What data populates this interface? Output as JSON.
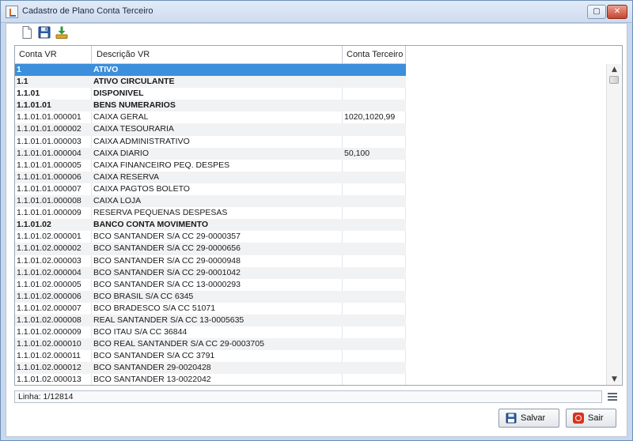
{
  "window": {
    "title": "Cadastro de Plano Conta Terceiro",
    "restore_glyph": "▢",
    "close_glyph": "✕"
  },
  "toolbar": {
    "buttons": [
      {
        "icon": "new-document-icon"
      },
      {
        "icon": "save-floppy-icon"
      },
      {
        "icon": "import-download-icon"
      }
    ]
  },
  "table": {
    "headers": [
      "Conta VR",
      "Descrição VR",
      "Conta Terceiro"
    ],
    "rows": [
      {
        "conta": "1",
        "descricao": "ATIVO",
        "terceiro": "",
        "bold": true,
        "selected": true
      },
      {
        "conta": "1.1",
        "descricao": "ATIVO CIRCULANTE",
        "terceiro": "",
        "bold": true
      },
      {
        "conta": "1.1.01",
        "descricao": "DISPONIVEL",
        "terceiro": "",
        "bold": true
      },
      {
        "conta": "1.1.01.01",
        "descricao": "BENS NUMERARIOS",
        "terceiro": "",
        "bold": true
      },
      {
        "conta": "1.1.01.01.000001",
        "descricao": "CAIXA GERAL",
        "terceiro": "1020,1020,99"
      },
      {
        "conta": "1.1.01.01.000002",
        "descricao": "CAIXA TESOURARIA",
        "terceiro": ""
      },
      {
        "conta": "1.1.01.01.000003",
        "descricao": "CAIXA ADMINISTRATIVO",
        "terceiro": ""
      },
      {
        "conta": "1.1.01.01.000004",
        "descricao": "CAIXA DIARIO",
        "terceiro": "50,100"
      },
      {
        "conta": "1.1.01.01.000005",
        "descricao": "CAIXA  FINANCEIRO PEQ. DESPES",
        "terceiro": ""
      },
      {
        "conta": "1.1.01.01.000006",
        "descricao": "CAIXA RESERVA",
        "terceiro": ""
      },
      {
        "conta": "1.1.01.01.000007",
        "descricao": "CAIXA PAGTOS BOLETO",
        "terceiro": ""
      },
      {
        "conta": "1.1.01.01.000008",
        "descricao": "CAIXA LOJA",
        "terceiro": ""
      },
      {
        "conta": "1.1.01.01.000009",
        "descricao": "RESERVA PEQUENAS DESPESAS",
        "terceiro": ""
      },
      {
        "conta": "1.1.01.02",
        "descricao": "BANCO CONTA MOVIMENTO",
        "terceiro": "",
        "bold": true
      },
      {
        "conta": "1.1.01.02.000001",
        "descricao": "BCO SANTANDER S/A CC 29-0000357",
        "terceiro": ""
      },
      {
        "conta": "1.1.01.02.000002",
        "descricao": "BCO SANTANDER S/A CC 29-0000656",
        "terceiro": ""
      },
      {
        "conta": "1.1.01.02.000003",
        "descricao": "BCO SANTANDER S/A CC 29-0000948",
        "terceiro": ""
      },
      {
        "conta": "1.1.01.02.000004",
        "descricao": "BCO SANTANDER S/A CC 29-0001042",
        "terceiro": ""
      },
      {
        "conta": "1.1.01.02.000005",
        "descricao": "BCO SANTANDER S/A CC 13-0000293",
        "terceiro": ""
      },
      {
        "conta": "1.1.01.02.000006",
        "descricao": "BCO BRASIL S/A CC 6345",
        "terceiro": ""
      },
      {
        "conta": "1.1.01.02.000007",
        "descricao": "BCO BRADESCO S/A CC 51071",
        "terceiro": ""
      },
      {
        "conta": "1.1.01.02.000008",
        "descricao": "REAL SANTANDER S/A CC 13-0005635",
        "terceiro": ""
      },
      {
        "conta": "1.1.01.02.000009",
        "descricao": "BCO ITAU S/A CC 36844",
        "terceiro": ""
      },
      {
        "conta": "1.1.01.02.000010",
        "descricao": "BCO REAL SANTANDER S/A CC 29-0003705",
        "terceiro": ""
      },
      {
        "conta": "1.1.01.02.000011",
        "descricao": "BCO SANTANDER S/A  CC 3791",
        "terceiro": ""
      },
      {
        "conta": "1.1.01.02.000012",
        "descricao": "BCO SANTANDER 29-0020428",
        "terceiro": ""
      },
      {
        "conta": "1.1.01.02.000013",
        "descricao": "BCO SANTANDER 13-0022042",
        "terceiro": ""
      }
    ]
  },
  "scrollbar": {
    "up_glyph": "▲",
    "down_glyph": "▼"
  },
  "status": {
    "linha": "Linha: 1/12814"
  },
  "buttons": {
    "salvar": "Salvar",
    "sair": "Sair"
  },
  "colors": {
    "selection": "#3b8fdc",
    "exit_icon": "#d8321f"
  }
}
